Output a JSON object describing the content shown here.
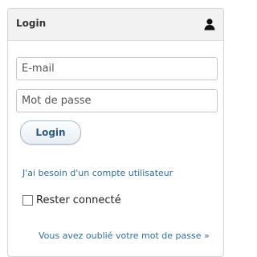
{
  "panel": {
    "title": "Login",
    "header_icon": "user-icon"
  },
  "form": {
    "email_placeholder": "E-mail",
    "password_placeholder": "Mot de passe",
    "login_button_label": "Login",
    "need_account_link": "J'ai besoin d'un compte utilisateur",
    "remember_me_label": "Rester connecté",
    "remember_me_checked": false,
    "forgot_password_link": "Vous avez oublié votre mot de passe »"
  },
  "colors": {
    "link": "#2a6ea8",
    "button_text": "#2a5d8c",
    "header_bg": "#f2f2f2"
  }
}
